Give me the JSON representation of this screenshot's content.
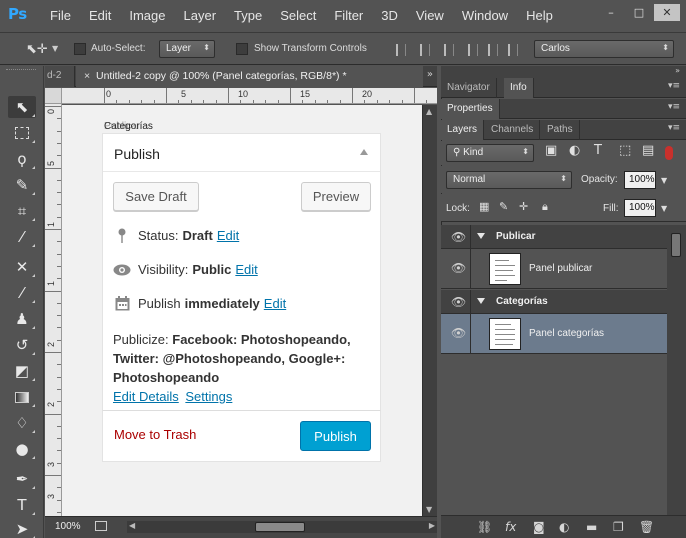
{
  "app": {
    "logo": "Ps",
    "menu": [
      "File",
      "Edit",
      "Image",
      "Layer",
      "Type",
      "Select",
      "Filter",
      "3D",
      "View",
      "Window",
      "Help"
    ],
    "window_controls": {
      "minimize": "–",
      "maximize": "□",
      "close": "✕"
    }
  },
  "options_bar": {
    "tool_icon": "move-tool-icon",
    "auto_select_label": "Auto-Select:",
    "auto_select_checked": false,
    "auto_select_target": "Layer",
    "show_transform_label": "Show Transform Controls",
    "show_transform_checked": false,
    "workspace": "Carlos"
  },
  "tabs": {
    "previous": "d-2",
    "current_title": "Untitled-2 copy @ 100% (Panel categorías, RGB/8*) *",
    "close_glyph": "×",
    "more_glyph": "»"
  },
  "rulers": {
    "top": [
      "0",
      "5",
      "10",
      "15",
      "20"
    ],
    "left": [
      "0",
      "5",
      "1",
      "1",
      "2",
      "2",
      "3",
      "3",
      "4"
    ]
  },
  "canvas": {
    "section_label": "Categorías",
    "section_label_ghost": "Publicar",
    "publish_box": {
      "title": "Publish",
      "save_draft": "Save Draft",
      "preview": "Preview",
      "status_label": "Status:",
      "status_value": "Draft",
      "status_edit": "Edit",
      "visibility_label": "Visibility:",
      "visibility_value": "Public",
      "visibility_edit": "Edit",
      "publish_label": "Publish",
      "publish_value": "immediately",
      "publish_edit": "Edit",
      "publicize_label": "Publicize:",
      "publicize_value": "Facebook: Photoshopeando, Twitter: @Photoshopeando, Google+: Photoshopeando",
      "edit_details": "Edit Details",
      "settings": "Settings",
      "move_to_trash": "Move to Trash",
      "publish_button": "Publish"
    },
    "colors": {
      "link": "#0073aa",
      "trash": "#aa0000",
      "publish_bg": "#00a0d2"
    }
  },
  "status_bar": {
    "zoom": "100%"
  },
  "panels": {
    "top_tabs": [
      "Navigator",
      "Info"
    ],
    "top_active": "Info",
    "properties_tab": "Properties",
    "layer_tabs": [
      "Layers",
      "Channels",
      "Paths"
    ],
    "layer_active": "Layers",
    "filter_kind": "Kind",
    "blend_mode": "Normal",
    "opacity_label": "Opacity:",
    "opacity_value": "100%",
    "lock_label": "Lock:",
    "fill_label": "Fill:",
    "fill_value": "100%",
    "menu_glyph": "▾≡",
    "collapse_glyph": "»"
  },
  "layers": [
    {
      "type": "group",
      "name": "Publicar",
      "visible": true
    },
    {
      "type": "layer",
      "name": "Panel publicar",
      "visible": true,
      "selected": false
    },
    {
      "type": "group",
      "name": "Categorías",
      "visible": true
    },
    {
      "type": "layer",
      "name": "Panel categorías",
      "visible": true,
      "selected": true
    }
  ],
  "layers_bottom_icons": [
    "link-layers-icon",
    "fx-icon",
    "add-mask-icon",
    "adjustment-layer-icon",
    "new-group-icon",
    "new-layer-icon",
    "delete-layer-icon"
  ],
  "layers_bottom_fx": "fx"
}
